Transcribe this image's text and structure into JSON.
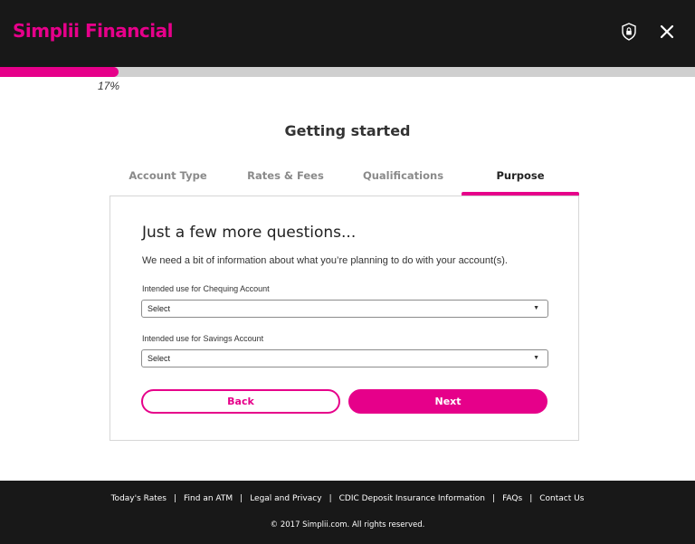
{
  "header": {
    "brand": "Simplii Financial",
    "brand_color": "#e6008a",
    "security_icon": "shield-lock-icon",
    "close_icon": "close-icon"
  },
  "progress": {
    "percent": 17,
    "label": "17%"
  },
  "page": {
    "title": "Getting started"
  },
  "tabs": [
    {
      "label": "Account Type",
      "active": false
    },
    {
      "label": "Rates & Fees",
      "active": false
    },
    {
      "label": "Qualifications",
      "active": false
    },
    {
      "label": "Purpose",
      "active": true
    }
  ],
  "form": {
    "heading": "Just a few more questions...",
    "intro": "We need a bit of information about what you’re planning to do with your account(s).",
    "chequing": {
      "label": "Intended use for Chequing Account",
      "value": "Select"
    },
    "savings": {
      "label": "Intended use for Savings Account",
      "value": "Select"
    },
    "back_label": "Back",
    "next_label": "Next"
  },
  "footer": {
    "links": [
      "Today's Rates",
      "Find an ATM",
      "Legal and Privacy",
      "CDIC Deposit Insurance Information",
      "FAQs",
      "Contact Us"
    ],
    "copyright": "© 2017 Simplii.com. All rights reserved."
  }
}
